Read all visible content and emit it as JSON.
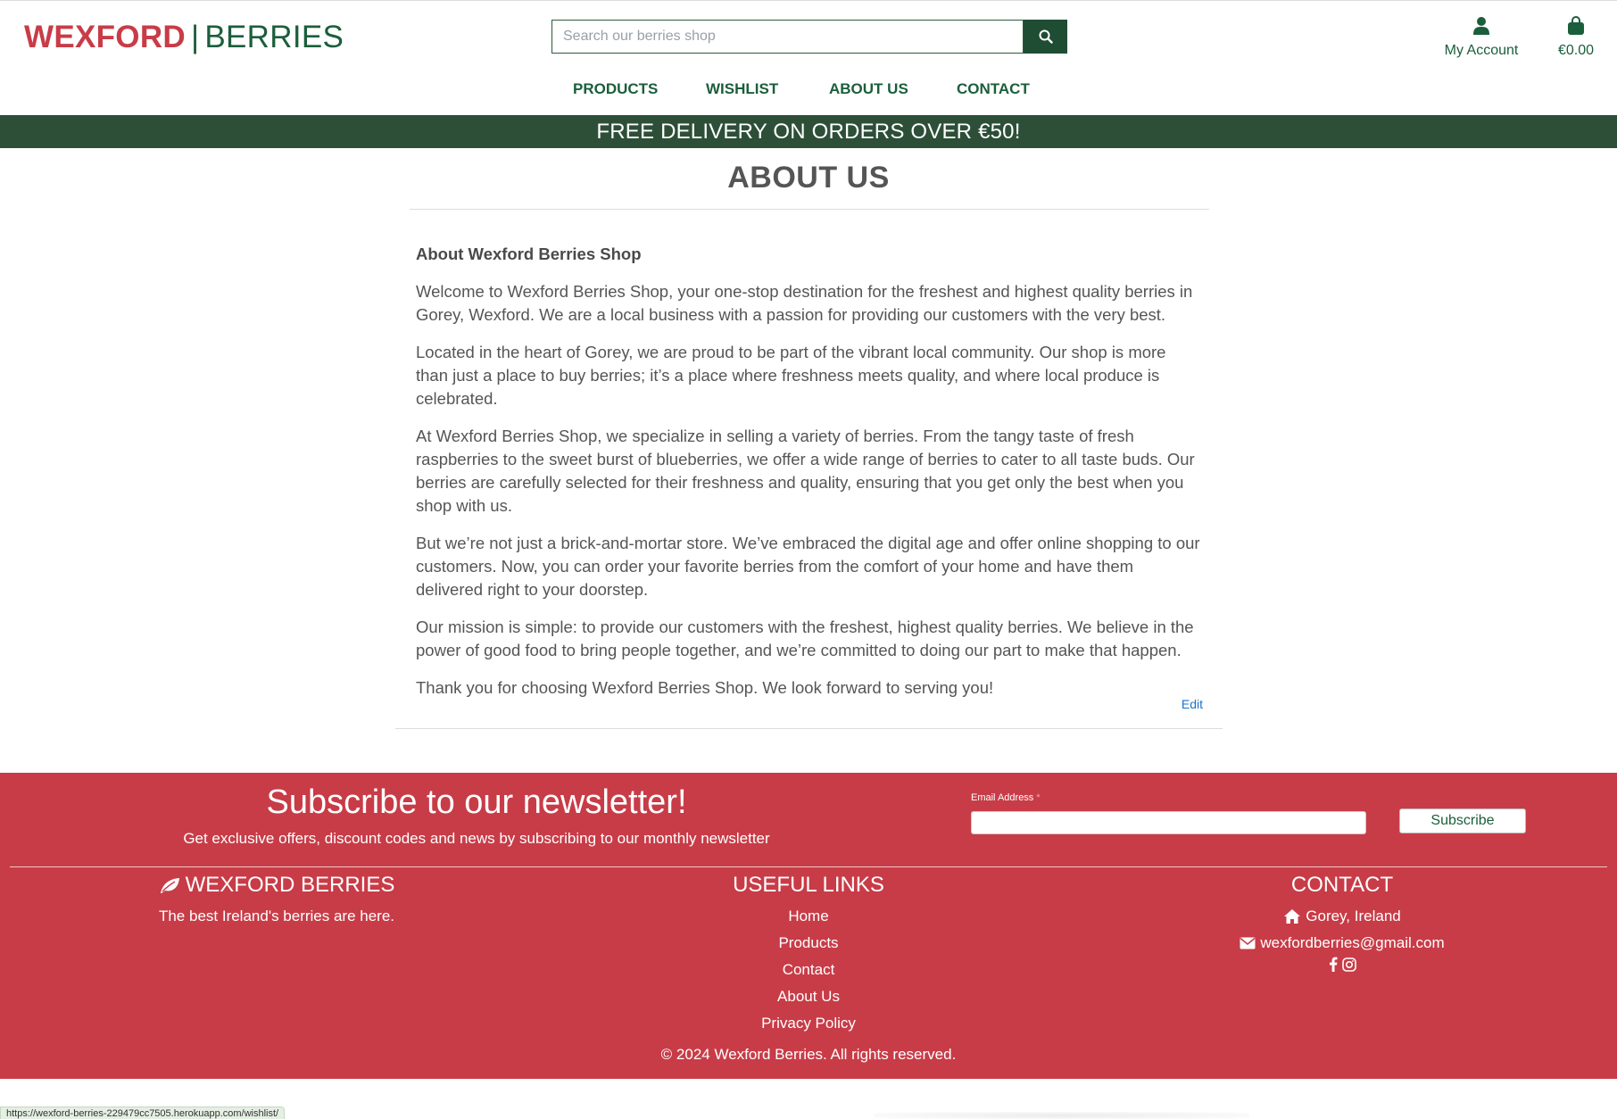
{
  "header": {
    "logo_part1": "WEXFORD",
    "logo_separator": "|",
    "logo_part2": "BERRIES",
    "search_placeholder": "Search our berries shop",
    "search_icon": "search-icon",
    "account_label": "My Account",
    "account_icon": "user-icon",
    "bag_label": "€0.00",
    "bag_icon": "shopping-bag-icon"
  },
  "nav": {
    "items": [
      {
        "label": "PRODUCTS"
      },
      {
        "label": "WISHLIST"
      },
      {
        "label": "ABOUT US"
      },
      {
        "label": "CONTACT"
      }
    ]
  },
  "banner": {
    "text": "FREE DELIVERY ON ORDERS OVER €50!"
  },
  "main": {
    "title": "ABOUT US",
    "heading": "About Wexford Berries Shop",
    "paragraphs": [
      "Welcome to Wexford Berries Shop, your one-stop destination for the freshest and highest quality berries in Gorey, Wexford. We are a local business with a passion for providing our customers with the very best.",
      "Located in the heart of Gorey, we are proud to be part of the vibrant local community. Our shop is more than just a place to buy berries; it’s a place where freshness meets quality, and where local produce is celebrated.",
      "At Wexford Berries Shop, we specialize in selling a variety of berries. From the tangy taste of fresh raspberries to the sweet burst of blueberries, we offer a wide range of berries to cater to all taste buds. Our berries are carefully selected for their freshness and quality, ensuring that you get only the best when you shop with us.",
      "But we’re not just a brick-and-mortar store. We’ve embraced the digital age and offer online shopping to our customers. Now, you can order your favorite berries from the comfort of your home and have them delivered right to your doorstep.",
      "Our mission is simple: to provide our customers with the freshest, highest quality berries. We believe in the power of good food to bring people together, and we’re committed to doing our part to make that happen.",
      "Thank you for choosing Wexford Berries Shop. We look forward to serving you!"
    ],
    "edit_label": "Edit"
  },
  "footer": {
    "newsletter_title": "Subscribe to our newsletter!",
    "newsletter_subtitle": "Get exclusive offers, discount codes and news by subscribing to our monthly newsletter",
    "email_label": "Email Address",
    "email_required_mark": "*",
    "subscribe_label": "Subscribe",
    "brand_heading": "WEXFORD BERRIES",
    "brand_icon": "leaf-icon",
    "brand_tagline": "The best Ireland's berries are here.",
    "links_heading": "USEFUL LINKS",
    "links": [
      {
        "label": "Home"
      },
      {
        "label": "Products"
      },
      {
        "label": "Contact"
      },
      {
        "label": "About Us"
      },
      {
        "label": "Privacy Policy"
      }
    ],
    "contact_heading": "CONTACT",
    "contact_location": "Gorey, Ireland",
    "contact_location_icon": "home-icon",
    "contact_email": "wexfordberries@gmail.com",
    "contact_email_icon": "envelope-icon",
    "social_icons": [
      "facebook-icon",
      "instagram-icon"
    ],
    "copyright": "© 2024 Wexford Berries. All rights reserved."
  },
  "status_url": "https://wexford-berries-229479cc7505.herokuapp.com/wishlist/",
  "colors": {
    "brand_red": "#c83c47",
    "brand_green": "#1b5e3b",
    "banner_green": "#2d4f38",
    "link_blue": "#1a73c8"
  }
}
